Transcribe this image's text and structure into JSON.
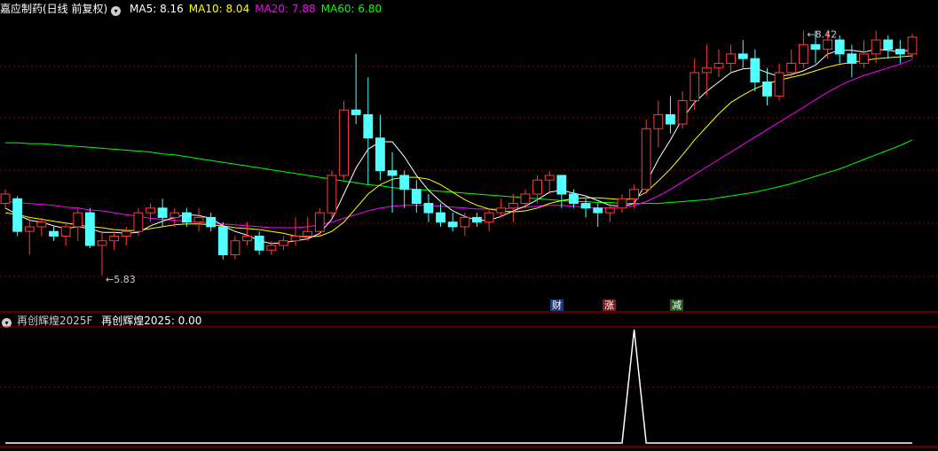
{
  "main_panel": {
    "stock_title": "嘉应制药(日线 前复权)",
    "ma_labels": [
      {
        "text": "MA5: 8.16",
        "color": "#ffffff"
      },
      {
        "text": "MA10: 8.04",
        "color": "#ffff00"
      },
      {
        "text": "MA20: 7.88",
        "color": "#ff00ff"
      },
      {
        "text": "MA60: 6.80",
        "color": "#00ff00"
      }
    ],
    "high_mark": "8.42",
    "low_mark": "5.83",
    "event_tags": [
      {
        "text": "财",
        "bg": "#1e3a7a",
        "fg": "#ffffff"
      },
      {
        "text": "涨",
        "bg": "#7a1e1e",
        "fg": "#ffffff"
      },
      {
        "text": "减",
        "bg": "#1e5a1e",
        "fg": "#ffffff"
      }
    ]
  },
  "sub_panel": {
    "indicator_name": "再创辉煌2025F",
    "indicator_value": "再创辉煌2025: 0.00"
  },
  "colors": {
    "up": "#ff3c3c",
    "down": "#54ffff",
    "ma5": "#ffffff",
    "ma10": "#ffff00",
    "ma20": "#ff00ff",
    "ma60": "#00ff00",
    "grid": "#8b0000",
    "frame": "#b00000"
  },
  "chart_data": {
    "type": "candlestick",
    "y_range": [
      5.6,
      8.55
    ],
    "candles": [
      [
        6.6,
        6.75,
        6.55,
        6.7
      ],
      [
        6.65,
        6.68,
        6.25,
        6.3
      ],
      [
        6.3,
        6.45,
        6.05,
        6.35
      ],
      [
        6.35,
        6.45,
        6.25,
        6.4
      ],
      [
        6.3,
        6.35,
        6.2,
        6.25
      ],
      [
        6.25,
        6.4,
        6.15,
        6.35
      ],
      [
        6.35,
        6.55,
        6.2,
        6.5
      ],
      [
        6.5,
        6.55,
        6.12,
        6.15
      ],
      [
        6.15,
        6.3,
        5.83,
        6.2
      ],
      [
        6.2,
        6.3,
        6.1,
        6.25
      ],
      [
        6.25,
        6.35,
        6.15,
        6.3
      ],
      [
        6.3,
        6.55,
        6.25,
        6.5
      ],
      [
        6.5,
        6.6,
        6.4,
        6.55
      ],
      [
        6.55,
        6.65,
        6.35,
        6.45
      ],
      [
        6.45,
        6.55,
        6.35,
        6.5
      ],
      [
        6.5,
        6.55,
        6.35,
        6.4
      ],
      [
        6.4,
        6.55,
        6.3,
        6.45
      ],
      [
        6.45,
        6.5,
        6.3,
        6.35
      ],
      [
        6.35,
        6.4,
        6.0,
        6.05
      ],
      [
        6.05,
        6.25,
        6.0,
        6.2
      ],
      [
        6.2,
        6.4,
        6.15,
        6.25
      ],
      [
        6.25,
        6.3,
        6.05,
        6.1
      ],
      [
        6.1,
        6.2,
        6.05,
        6.15
      ],
      [
        6.15,
        6.25,
        6.1,
        6.2
      ],
      [
        6.2,
        6.45,
        6.15,
        6.25
      ],
      [
        6.25,
        6.45,
        6.2,
        6.3
      ],
      [
        6.3,
        6.55,
        6.25,
        6.5
      ],
      [
        6.5,
        6.95,
        6.45,
        6.9
      ],
      [
        6.9,
        7.7,
        6.85,
        7.6
      ],
      [
        7.6,
        8.2,
        7.45,
        7.55
      ],
      [
        7.55,
        7.95,
        6.8,
        7.3
      ],
      [
        7.3,
        7.55,
        6.85,
        6.95
      ],
      [
        6.95,
        7.15,
        6.5,
        6.9
      ],
      [
        6.9,
        6.95,
        6.55,
        6.75
      ],
      [
        6.75,
        6.85,
        6.5,
        6.6
      ],
      [
        6.6,
        6.7,
        6.4,
        6.5
      ],
      [
        6.5,
        6.6,
        6.35,
        6.4
      ],
      [
        6.4,
        6.5,
        6.3,
        6.35
      ],
      [
        6.35,
        6.5,
        6.25,
        6.45
      ],
      [
        6.45,
        6.5,
        6.35,
        6.4
      ],
      [
        6.4,
        6.55,
        6.3,
        6.5
      ],
      [
        6.5,
        6.65,
        6.45,
        6.55
      ],
      [
        6.55,
        6.7,
        6.4,
        6.6
      ],
      [
        6.6,
        6.75,
        6.55,
        6.7
      ],
      [
        6.7,
        6.9,
        6.6,
        6.85
      ],
      [
        6.85,
        6.95,
        6.7,
        6.9
      ],
      [
        6.9,
        6.9,
        6.55,
        6.7
      ],
      [
        6.7,
        6.75,
        6.55,
        6.6
      ],
      [
        6.6,
        6.65,
        6.45,
        6.55
      ],
      [
        6.55,
        6.6,
        6.35,
        6.5
      ],
      [
        6.5,
        6.6,
        6.4,
        6.55
      ],
      [
        6.55,
        6.7,
        6.5,
        6.65
      ],
      [
        6.65,
        6.8,
        6.55,
        6.75
      ],
      [
        6.75,
        7.5,
        6.7,
        7.4
      ],
      [
        7.4,
        7.7,
        7.2,
        7.55
      ],
      [
        7.55,
        7.75,
        7.35,
        7.45
      ],
      [
        7.45,
        7.8,
        7.4,
        7.7
      ],
      [
        7.7,
        8.15,
        7.6,
        8.0
      ],
      [
        8.0,
        8.3,
        7.75,
        8.05
      ],
      [
        8.05,
        8.25,
        7.95,
        8.1
      ],
      [
        8.1,
        8.3,
        8.0,
        8.2
      ],
      [
        8.2,
        8.35,
        8.05,
        8.15
      ],
      [
        8.15,
        8.25,
        7.8,
        7.9
      ],
      [
        7.9,
        8.05,
        7.65,
        7.75
      ],
      [
        7.75,
        8.1,
        7.7,
        8.0
      ],
      [
        8.0,
        8.25,
        7.95,
        8.1
      ],
      [
        8.1,
        8.45,
        8.05,
        8.3
      ],
      [
        8.3,
        8.45,
        8.1,
        8.25
      ],
      [
        8.25,
        8.45,
        8.15,
        8.35
      ],
      [
        8.35,
        8.4,
        8.1,
        8.2
      ],
      [
        8.2,
        8.3,
        7.95,
        8.1
      ],
      [
        8.1,
        8.35,
        8.05,
        8.2
      ],
      [
        8.2,
        8.45,
        8.1,
        8.35
      ],
      [
        8.35,
        8.4,
        8.15,
        8.25
      ],
      [
        8.25,
        8.35,
        8.1,
        8.2
      ],
      [
        8.2,
        8.42,
        8.15,
        8.38
      ]
    ],
    "ma5": [
      6.55,
      6.48,
      6.42,
      6.4,
      6.36,
      6.33,
      6.35,
      6.33,
      6.29,
      6.29,
      6.28,
      6.29,
      6.36,
      6.41,
      6.45,
      6.48,
      6.47,
      6.44,
      6.36,
      6.3,
      6.26,
      6.2,
      6.17,
      6.18,
      6.2,
      6.22,
      6.28,
      6.43,
      6.7,
      6.98,
      7.18,
      7.26,
      7.26,
      7.1,
      6.9,
      6.74,
      6.62,
      6.52,
      6.46,
      6.42,
      6.42,
      6.46,
      6.52,
      6.57,
      6.64,
      6.72,
      6.74,
      6.71,
      6.68,
      6.63,
      6.58,
      6.57,
      6.6,
      6.82,
      7.07,
      7.28,
      7.51,
      7.68,
      7.8,
      7.9,
      8.0,
      8.04,
      8.05,
      8.0,
      7.96,
      7.98,
      8.02,
      8.08,
      8.2,
      8.24,
      8.24,
      8.22,
      8.25,
      8.24,
      8.22,
      8.25
    ],
    "ma10": [
      6.5,
      6.48,
      6.45,
      6.43,
      6.41,
      6.39,
      6.37,
      6.35,
      6.34,
      6.32,
      6.31,
      6.31,
      6.33,
      6.35,
      6.37,
      6.38,
      6.38,
      6.37,
      6.36,
      6.34,
      6.33,
      6.32,
      6.3,
      6.28,
      6.25,
      6.24,
      6.25,
      6.3,
      6.4,
      6.55,
      6.7,
      6.8,
      6.86,
      6.88,
      6.88,
      6.86,
      6.8,
      6.72,
      6.64,
      6.58,
      6.54,
      6.52,
      6.51,
      6.52,
      6.55,
      6.6,
      6.63,
      6.65,
      6.66,
      6.66,
      6.65,
      6.64,
      6.65,
      6.72,
      6.84,
      6.97,
      7.12,
      7.28,
      7.42,
      7.56,
      7.68,
      7.76,
      7.83,
      7.88,
      7.92,
      7.95,
      7.98,
      8.02,
      8.06,
      8.09,
      8.11,
      8.13,
      8.15,
      8.16,
      8.17,
      8.18
    ],
    "ma20": [
      6.62,
      6.61,
      6.6,
      6.59,
      6.58,
      6.56,
      6.55,
      6.53,
      6.52,
      6.5,
      6.48,
      6.46,
      6.44,
      6.43,
      6.42,
      6.41,
      6.4,
      6.39,
      6.38,
      6.37,
      6.36,
      6.35,
      6.34,
      6.34,
      6.34,
      6.35,
      6.37,
      6.4,
      6.44,
      6.48,
      6.52,
      6.55,
      6.57,
      6.58,
      6.58,
      6.58,
      6.57,
      6.56,
      6.55,
      6.54,
      6.54,
      6.54,
      6.55,
      6.56,
      6.57,
      6.58,
      6.58,
      6.57,
      6.56,
      6.55,
      6.55,
      6.56,
      6.58,
      6.62,
      6.68,
      6.75,
      6.83,
      6.91,
      6.99,
      7.07,
      7.15,
      7.23,
      7.31,
      7.39,
      7.47,
      7.55,
      7.63,
      7.71,
      7.79,
      7.86,
      7.92,
      7.97,
      8.01,
      8.05,
      8.09,
      8.14
    ],
    "ma60": [
      7.25,
      7.25,
      7.24,
      7.24,
      7.23,
      7.22,
      7.21,
      7.2,
      7.19,
      7.18,
      7.17,
      7.16,
      7.15,
      7.13,
      7.12,
      7.1,
      7.08,
      7.06,
      7.04,
      7.02,
      7.0,
      6.98,
      6.96,
      6.94,
      6.92,
      6.9,
      6.88,
      6.86,
      6.84,
      6.82,
      6.8,
      6.79,
      6.77,
      6.76,
      6.75,
      6.74,
      6.73,
      6.72,
      6.71,
      6.7,
      6.69,
      6.68,
      6.67,
      6.66,
      6.65,
      6.64,
      6.63,
      6.62,
      6.62,
      6.61,
      6.61,
      6.6,
      6.6,
      6.6,
      6.6,
      6.61,
      6.62,
      6.63,
      6.64,
      6.66,
      6.68,
      6.7,
      6.72,
      6.75,
      6.78,
      6.81,
      6.85,
      6.89,
      6.93,
      6.97,
      7.02,
      7.07,
      7.12,
      7.17,
      7.22,
      7.28
    ],
    "indicator": [
      0,
      0,
      0,
      0,
      0,
      0,
      0,
      0,
      0,
      0,
      0,
      0,
      0,
      0,
      0,
      0,
      0,
      0,
      0,
      0,
      0,
      0,
      0,
      0,
      0,
      0,
      0,
      0,
      0,
      0,
      0,
      0,
      0,
      0,
      0,
      0,
      0,
      0,
      0,
      0,
      0,
      0,
      0,
      0,
      0,
      0,
      0,
      0,
      0,
      0,
      0,
      0,
      1,
      0,
      0,
      0,
      0,
      0,
      0,
      0,
      0,
      0,
      0,
      0,
      0,
      0,
      0,
      0,
      0,
      0,
      0,
      0,
      0,
      0,
      0,
      0
    ]
  }
}
